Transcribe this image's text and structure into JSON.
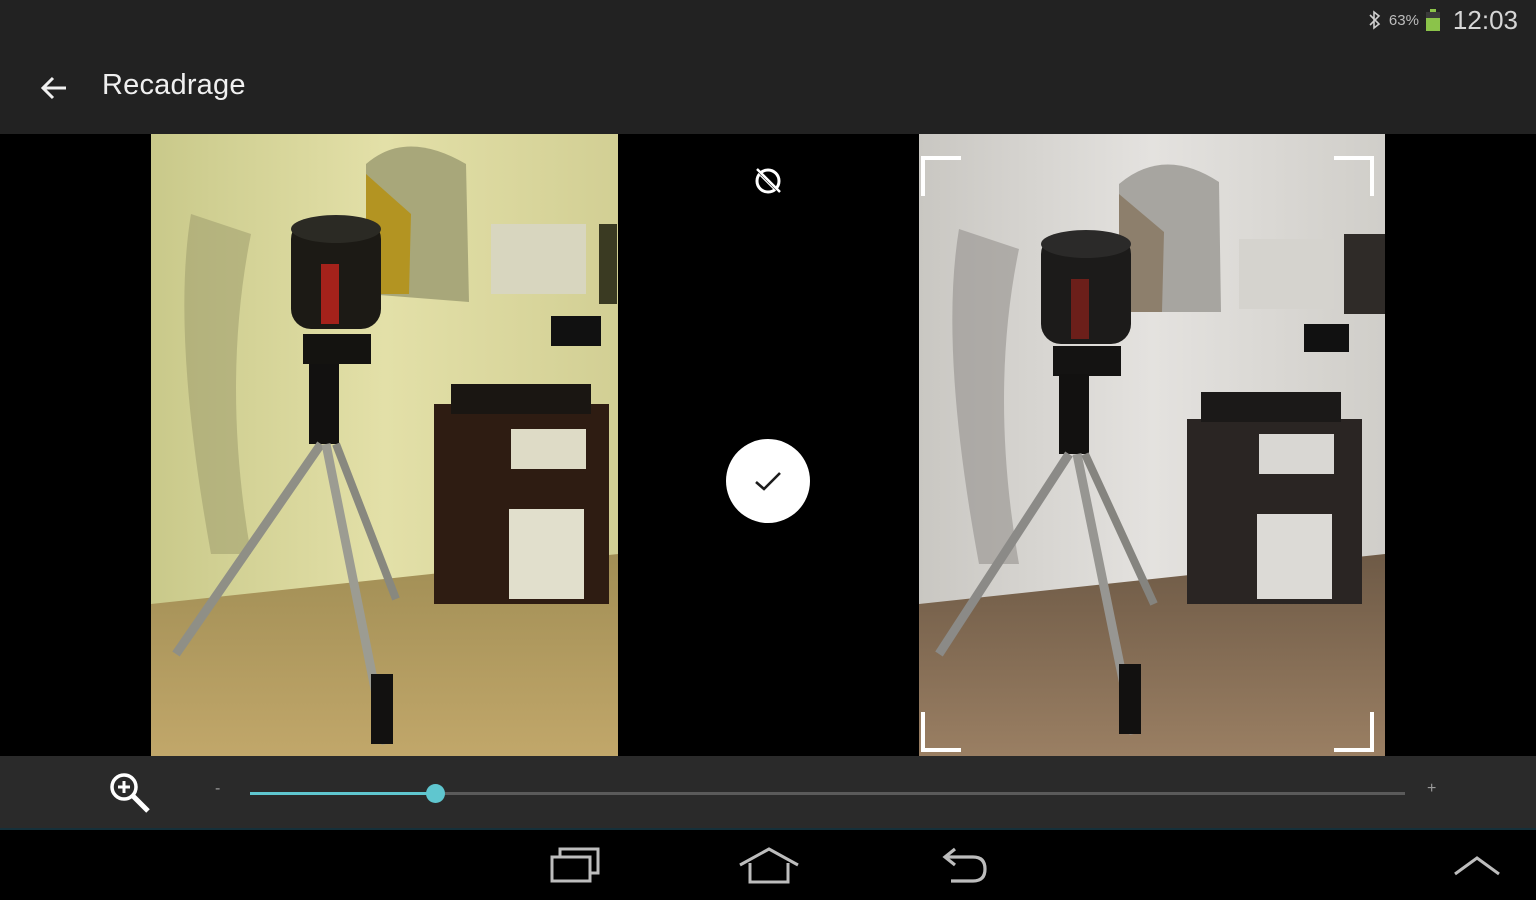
{
  "status_bar": {
    "battery_percent": "63%",
    "time": "12:03",
    "icons": [
      "bluetooth-icon",
      "battery-icon"
    ],
    "battery_color": "#8bc34a"
  },
  "action_bar": {
    "title": "Recadrage",
    "back_icon": "arrow-left-icon"
  },
  "editor": {
    "rotate_lock_icon": "rotation-lock-icon",
    "confirm_icon": "check-icon"
  },
  "zoom": {
    "icon": "zoom-in-icon",
    "minus_label": "-",
    "plus_label": "+",
    "level": 0.16,
    "accent_color": "#5fc6cf"
  },
  "nav_bar": {
    "buttons": [
      "recent-apps-icon",
      "home-icon",
      "back-icon",
      "up-chevron-icon"
    ]
  }
}
